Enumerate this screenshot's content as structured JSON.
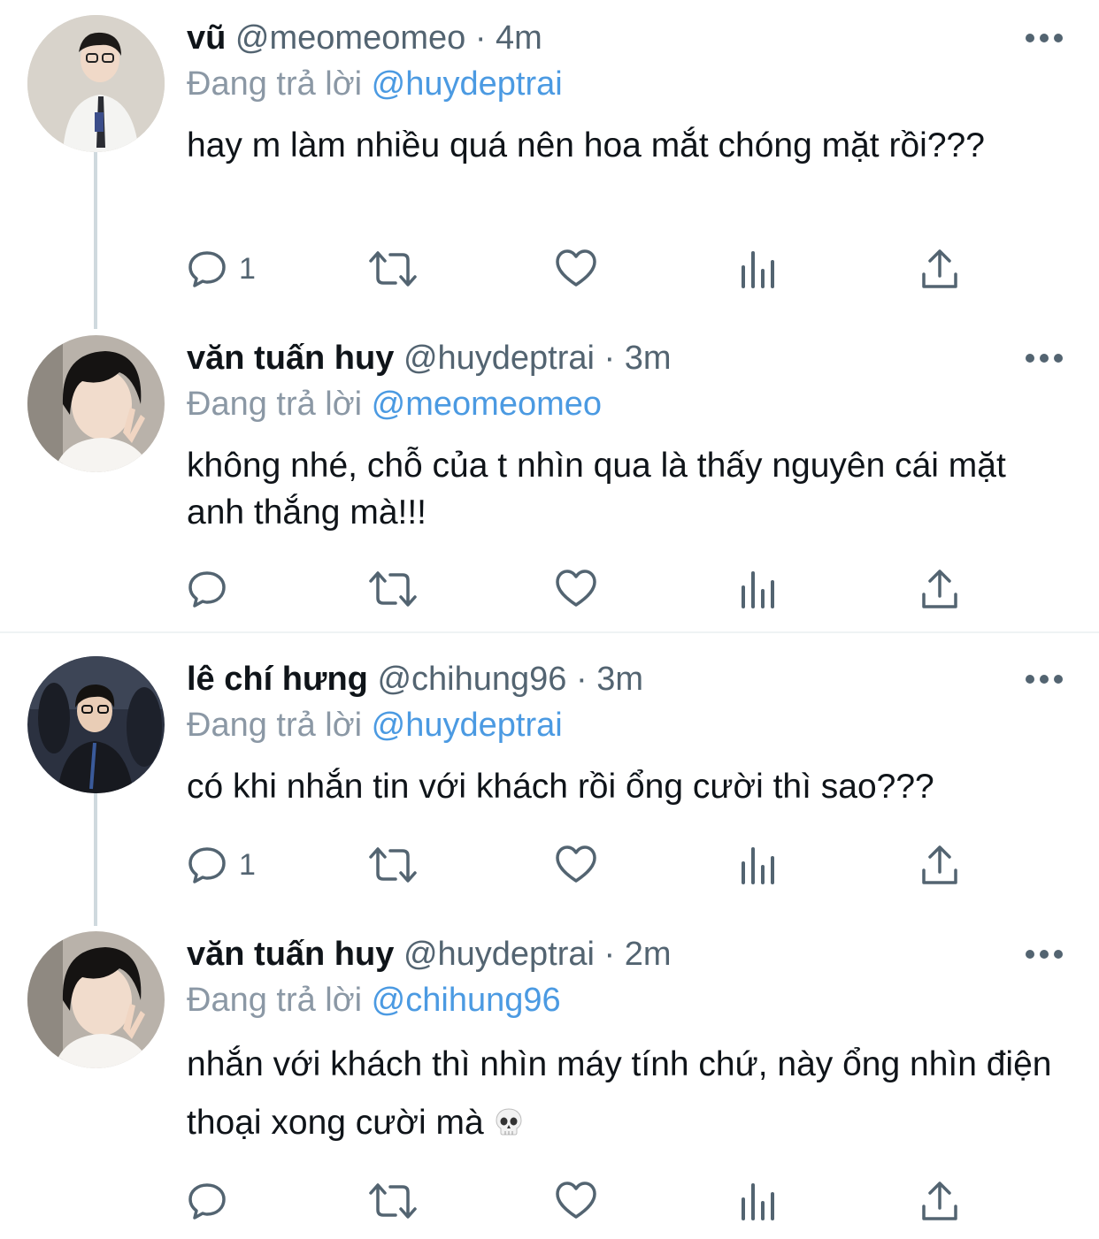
{
  "replying_prefix": "Đang trả lời",
  "tweets": [
    {
      "name": "vũ",
      "handle": "@meomeomeo",
      "sep": "·",
      "time": "4m",
      "replying_to": "@huydeptrai",
      "text": "hay m làm nhiều quá nên hoa mắt chóng mặt rồi???",
      "reply_count": "1"
    },
    {
      "name": "văn tuấn huy",
      "handle": "@huydeptrai",
      "sep": "·",
      "time": "3m",
      "replying_to": "@meomeomeo",
      "text": "không nhé, chỗ của t nhìn qua là thấy nguyên cái mặt anh thắng mà!!!",
      "reply_count": ""
    },
    {
      "name": "lê chí hưng",
      "handle": "@chihung96",
      "sep": "·",
      "time": "3m",
      "replying_to": "@huydeptrai",
      "text": "có khi nhắn tin với khách rồi ổng cười thì sao???",
      "reply_count": "1"
    },
    {
      "name": "văn tuấn huy",
      "handle": "@huydeptrai",
      "sep": "·",
      "time": "2m",
      "replying_to": "@chihung96",
      "text": "nhắn với khách thì nhìn máy tính chứ, này ổng nhìn điện thoại xong cười mà",
      "reply_count": ""
    }
  ],
  "colors": {
    "mention": "#4b9ae2",
    "secondary": "#536471",
    "thread_line": "#cfd9de",
    "icon": "#536471"
  },
  "icons": [
    "reply-icon",
    "retweet-icon",
    "like-icon",
    "views-icon",
    "share-icon",
    "more-icon",
    "skull-emoji"
  ]
}
